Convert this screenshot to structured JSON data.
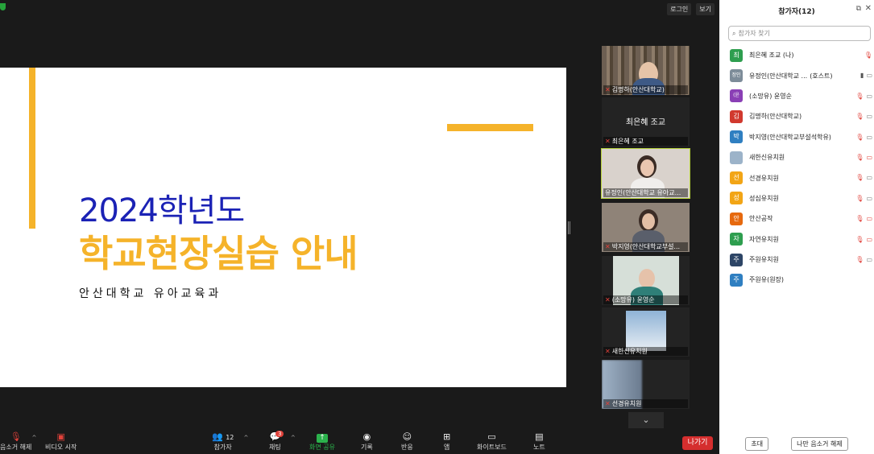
{
  "topbar": {
    "login_label": "로그인",
    "view_label": "보기"
  },
  "slide": {
    "line1": "2024학년도",
    "line2": "학교현장실습 안내",
    "line3": "안산대학교 유아교육과",
    "accent_color": "#f5b32a",
    "year_color": "#1b22b5"
  },
  "video_tiles": [
    {
      "name": "김명하(안산대학교)",
      "mic_muted": true
    },
    {
      "name": "최은혜 조교",
      "center_name": "최은혜 조교",
      "mic_muted": true
    },
    {
      "name": "유정인(안산대학교 유아교...",
      "mic_muted": false,
      "active_speaker": true
    },
    {
      "name": "박지영(안산대학교부설...",
      "mic_muted": true
    },
    {
      "name": "(소망유) 윤영순",
      "mic_muted": true
    },
    {
      "name": "새한신유치원",
      "mic_muted": true
    },
    {
      "name": "선경유치원",
      "mic_muted": true
    }
  ],
  "toolbar": {
    "mute_label": "음소거 해제",
    "video_label": "비디오 시작",
    "participants_label": "참가자",
    "participants_count": "12",
    "chat_label": "채팅",
    "chat_badge": "3",
    "share_label": "화면 공유",
    "record_label": "기록",
    "reactions_label": "반응",
    "apps_label": "앱",
    "whiteboard_label": "화이트보드",
    "notes_label": "노트",
    "leave_label": "나가기"
  },
  "panel": {
    "title": "참가자(12)",
    "search_placeholder": "참가자 찾기",
    "participants": [
      {
        "avatar": "최",
        "color": "#2e9e4f",
        "name": "최은혜 조교 (나)",
        "tag": "",
        "mic": "off",
        "video": "none"
      },
      {
        "avatar": "정인",
        "color": "#7d8c99",
        "name": "유정인(안산대학교 ...",
        "tag": "(호스트)",
        "mic": "on",
        "video": "off"
      },
      {
        "avatar": "(윤",
        "color": "#8a3fb5",
        "name": "(소망유) 윤영순",
        "tag": "",
        "mic": "off",
        "video": "off"
      },
      {
        "avatar": "김",
        "color": "#d1392e",
        "name": "김명하(안산대학교)",
        "tag": "",
        "mic": "off",
        "video": "off"
      },
      {
        "avatar": "박",
        "color": "#2f7fc1",
        "name": "박지영(안산대학교부설석학유)",
        "tag": "",
        "mic": "off",
        "video": "off"
      },
      {
        "avatar": "",
        "color": "#9cb3c9",
        "name": "새한신유치원",
        "tag": "",
        "mic": "off",
        "video": "off-red"
      },
      {
        "avatar": "선",
        "color": "#f2a516",
        "name": "선경유치원",
        "tag": "",
        "mic": "off",
        "video": "off"
      },
      {
        "avatar": "성",
        "color": "#f2a516",
        "name": "성심유치원",
        "tag": "",
        "mic": "off",
        "video": "off"
      },
      {
        "avatar": "안",
        "color": "#e6690e",
        "name": "안산공작",
        "tag": "",
        "mic": "off",
        "video": "off-red"
      },
      {
        "avatar": "자",
        "color": "#2e9e4f",
        "name": "자연유치원",
        "tag": "",
        "mic": "off",
        "video": "off-red"
      },
      {
        "avatar": "주",
        "color": "#2d4566",
        "name": "주원유치원",
        "tag": "",
        "mic": "off",
        "video": "off"
      },
      {
        "avatar": "주",
        "color": "#2f7fc1",
        "name": "주원유(원장)",
        "tag": "",
        "mic": "none",
        "video": "none"
      }
    ],
    "invite_label": "초대",
    "mute_all_label": "나만 음소거 해제"
  }
}
